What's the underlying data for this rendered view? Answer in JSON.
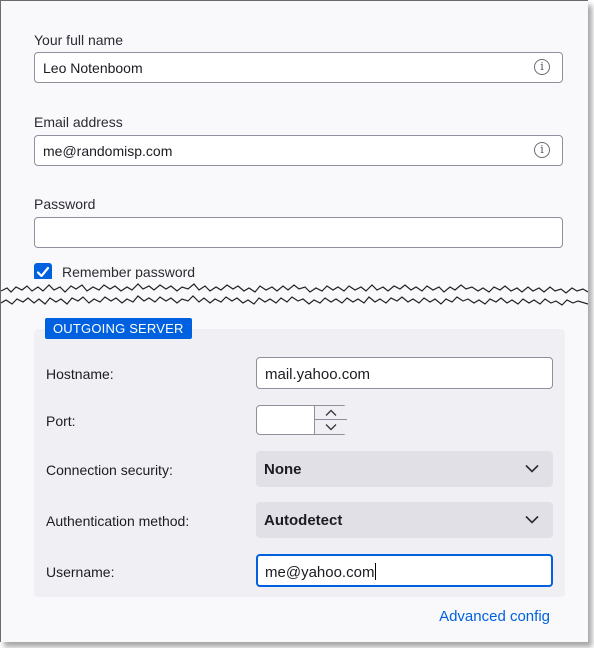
{
  "identity": {
    "full_name_label": "Your full name",
    "full_name_value": "Leo Notenboom",
    "email_label": "Email address",
    "email_value": "me@randomisp.com",
    "password_label": "Password",
    "password_value": "",
    "remember_label": "Remember password",
    "remember_checked": true
  },
  "outgoing": {
    "legend": "OUTGOING SERVER",
    "hostname_label": "Hostname:",
    "hostname_value": "mail.yahoo.com",
    "port_label": "Port:",
    "port_value": "",
    "security_label": "Connection security:",
    "security_value": "None",
    "auth_label": "Authentication method:",
    "auth_value": "Autodetect",
    "username_label": "Username:",
    "username_value": "me@yahoo.com"
  },
  "advanced_link": "Advanced config",
  "icons": {
    "info": "info-icon",
    "check": "checkmark-icon",
    "chevron": "chevron-down-icon",
    "spin_up": "chevron-up-icon",
    "spin_down": "chevron-down-icon"
  },
  "colors": {
    "accent": "#0061e0",
    "background": "#f9f9fb",
    "group_bg": "#f0f0f4",
    "select_bg": "#e0e0e6"
  }
}
